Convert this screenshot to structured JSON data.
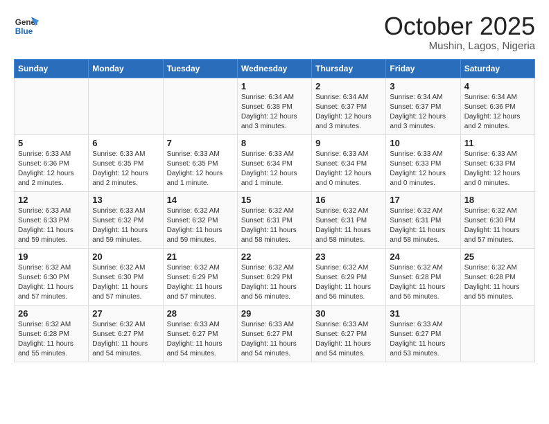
{
  "header": {
    "logo_line1": "General",
    "logo_line2": "Blue",
    "month": "October 2025",
    "location": "Mushin, Lagos, Nigeria"
  },
  "days_of_week": [
    "Sunday",
    "Monday",
    "Tuesday",
    "Wednesday",
    "Thursday",
    "Friday",
    "Saturday"
  ],
  "weeks": [
    [
      {
        "day": "",
        "info": ""
      },
      {
        "day": "",
        "info": ""
      },
      {
        "day": "",
        "info": ""
      },
      {
        "day": "1",
        "info": "Sunrise: 6:34 AM\nSunset: 6:38 PM\nDaylight: 12 hours\nand 3 minutes."
      },
      {
        "day": "2",
        "info": "Sunrise: 6:34 AM\nSunset: 6:37 PM\nDaylight: 12 hours\nand 3 minutes."
      },
      {
        "day": "3",
        "info": "Sunrise: 6:34 AM\nSunset: 6:37 PM\nDaylight: 12 hours\nand 3 minutes."
      },
      {
        "day": "4",
        "info": "Sunrise: 6:34 AM\nSunset: 6:36 PM\nDaylight: 12 hours\nand 2 minutes."
      }
    ],
    [
      {
        "day": "5",
        "info": "Sunrise: 6:33 AM\nSunset: 6:36 PM\nDaylight: 12 hours\nand 2 minutes."
      },
      {
        "day": "6",
        "info": "Sunrise: 6:33 AM\nSunset: 6:35 PM\nDaylight: 12 hours\nand 2 minutes."
      },
      {
        "day": "7",
        "info": "Sunrise: 6:33 AM\nSunset: 6:35 PM\nDaylight: 12 hours\nand 1 minute."
      },
      {
        "day": "8",
        "info": "Sunrise: 6:33 AM\nSunset: 6:34 PM\nDaylight: 12 hours\nand 1 minute."
      },
      {
        "day": "9",
        "info": "Sunrise: 6:33 AM\nSunset: 6:34 PM\nDaylight: 12 hours\nand 0 minutes."
      },
      {
        "day": "10",
        "info": "Sunrise: 6:33 AM\nSunset: 6:33 PM\nDaylight: 12 hours\nand 0 minutes."
      },
      {
        "day": "11",
        "info": "Sunrise: 6:33 AM\nSunset: 6:33 PM\nDaylight: 12 hours\nand 0 minutes."
      }
    ],
    [
      {
        "day": "12",
        "info": "Sunrise: 6:33 AM\nSunset: 6:33 PM\nDaylight: 11 hours\nand 59 minutes."
      },
      {
        "day": "13",
        "info": "Sunrise: 6:33 AM\nSunset: 6:32 PM\nDaylight: 11 hours\nand 59 minutes."
      },
      {
        "day": "14",
        "info": "Sunrise: 6:32 AM\nSunset: 6:32 PM\nDaylight: 11 hours\nand 59 minutes."
      },
      {
        "day": "15",
        "info": "Sunrise: 6:32 AM\nSunset: 6:31 PM\nDaylight: 11 hours\nand 58 minutes."
      },
      {
        "day": "16",
        "info": "Sunrise: 6:32 AM\nSunset: 6:31 PM\nDaylight: 11 hours\nand 58 minutes."
      },
      {
        "day": "17",
        "info": "Sunrise: 6:32 AM\nSunset: 6:31 PM\nDaylight: 11 hours\nand 58 minutes."
      },
      {
        "day": "18",
        "info": "Sunrise: 6:32 AM\nSunset: 6:30 PM\nDaylight: 11 hours\nand 57 minutes."
      }
    ],
    [
      {
        "day": "19",
        "info": "Sunrise: 6:32 AM\nSunset: 6:30 PM\nDaylight: 11 hours\nand 57 minutes."
      },
      {
        "day": "20",
        "info": "Sunrise: 6:32 AM\nSunset: 6:30 PM\nDaylight: 11 hours\nand 57 minutes."
      },
      {
        "day": "21",
        "info": "Sunrise: 6:32 AM\nSunset: 6:29 PM\nDaylight: 11 hours\nand 57 minutes."
      },
      {
        "day": "22",
        "info": "Sunrise: 6:32 AM\nSunset: 6:29 PM\nDaylight: 11 hours\nand 56 minutes."
      },
      {
        "day": "23",
        "info": "Sunrise: 6:32 AM\nSunset: 6:29 PM\nDaylight: 11 hours\nand 56 minutes."
      },
      {
        "day": "24",
        "info": "Sunrise: 6:32 AM\nSunset: 6:28 PM\nDaylight: 11 hours\nand 56 minutes."
      },
      {
        "day": "25",
        "info": "Sunrise: 6:32 AM\nSunset: 6:28 PM\nDaylight: 11 hours\nand 55 minutes."
      }
    ],
    [
      {
        "day": "26",
        "info": "Sunrise: 6:32 AM\nSunset: 6:28 PM\nDaylight: 11 hours\nand 55 minutes."
      },
      {
        "day": "27",
        "info": "Sunrise: 6:32 AM\nSunset: 6:27 PM\nDaylight: 11 hours\nand 54 minutes."
      },
      {
        "day": "28",
        "info": "Sunrise: 6:33 AM\nSunset: 6:27 PM\nDaylight: 11 hours\nand 54 minutes."
      },
      {
        "day": "29",
        "info": "Sunrise: 6:33 AM\nSunset: 6:27 PM\nDaylight: 11 hours\nand 54 minutes."
      },
      {
        "day": "30",
        "info": "Sunrise: 6:33 AM\nSunset: 6:27 PM\nDaylight: 11 hours\nand 54 minutes."
      },
      {
        "day": "31",
        "info": "Sunrise: 6:33 AM\nSunset: 6:27 PM\nDaylight: 11 hours\nand 53 minutes."
      },
      {
        "day": "",
        "info": ""
      }
    ]
  ]
}
